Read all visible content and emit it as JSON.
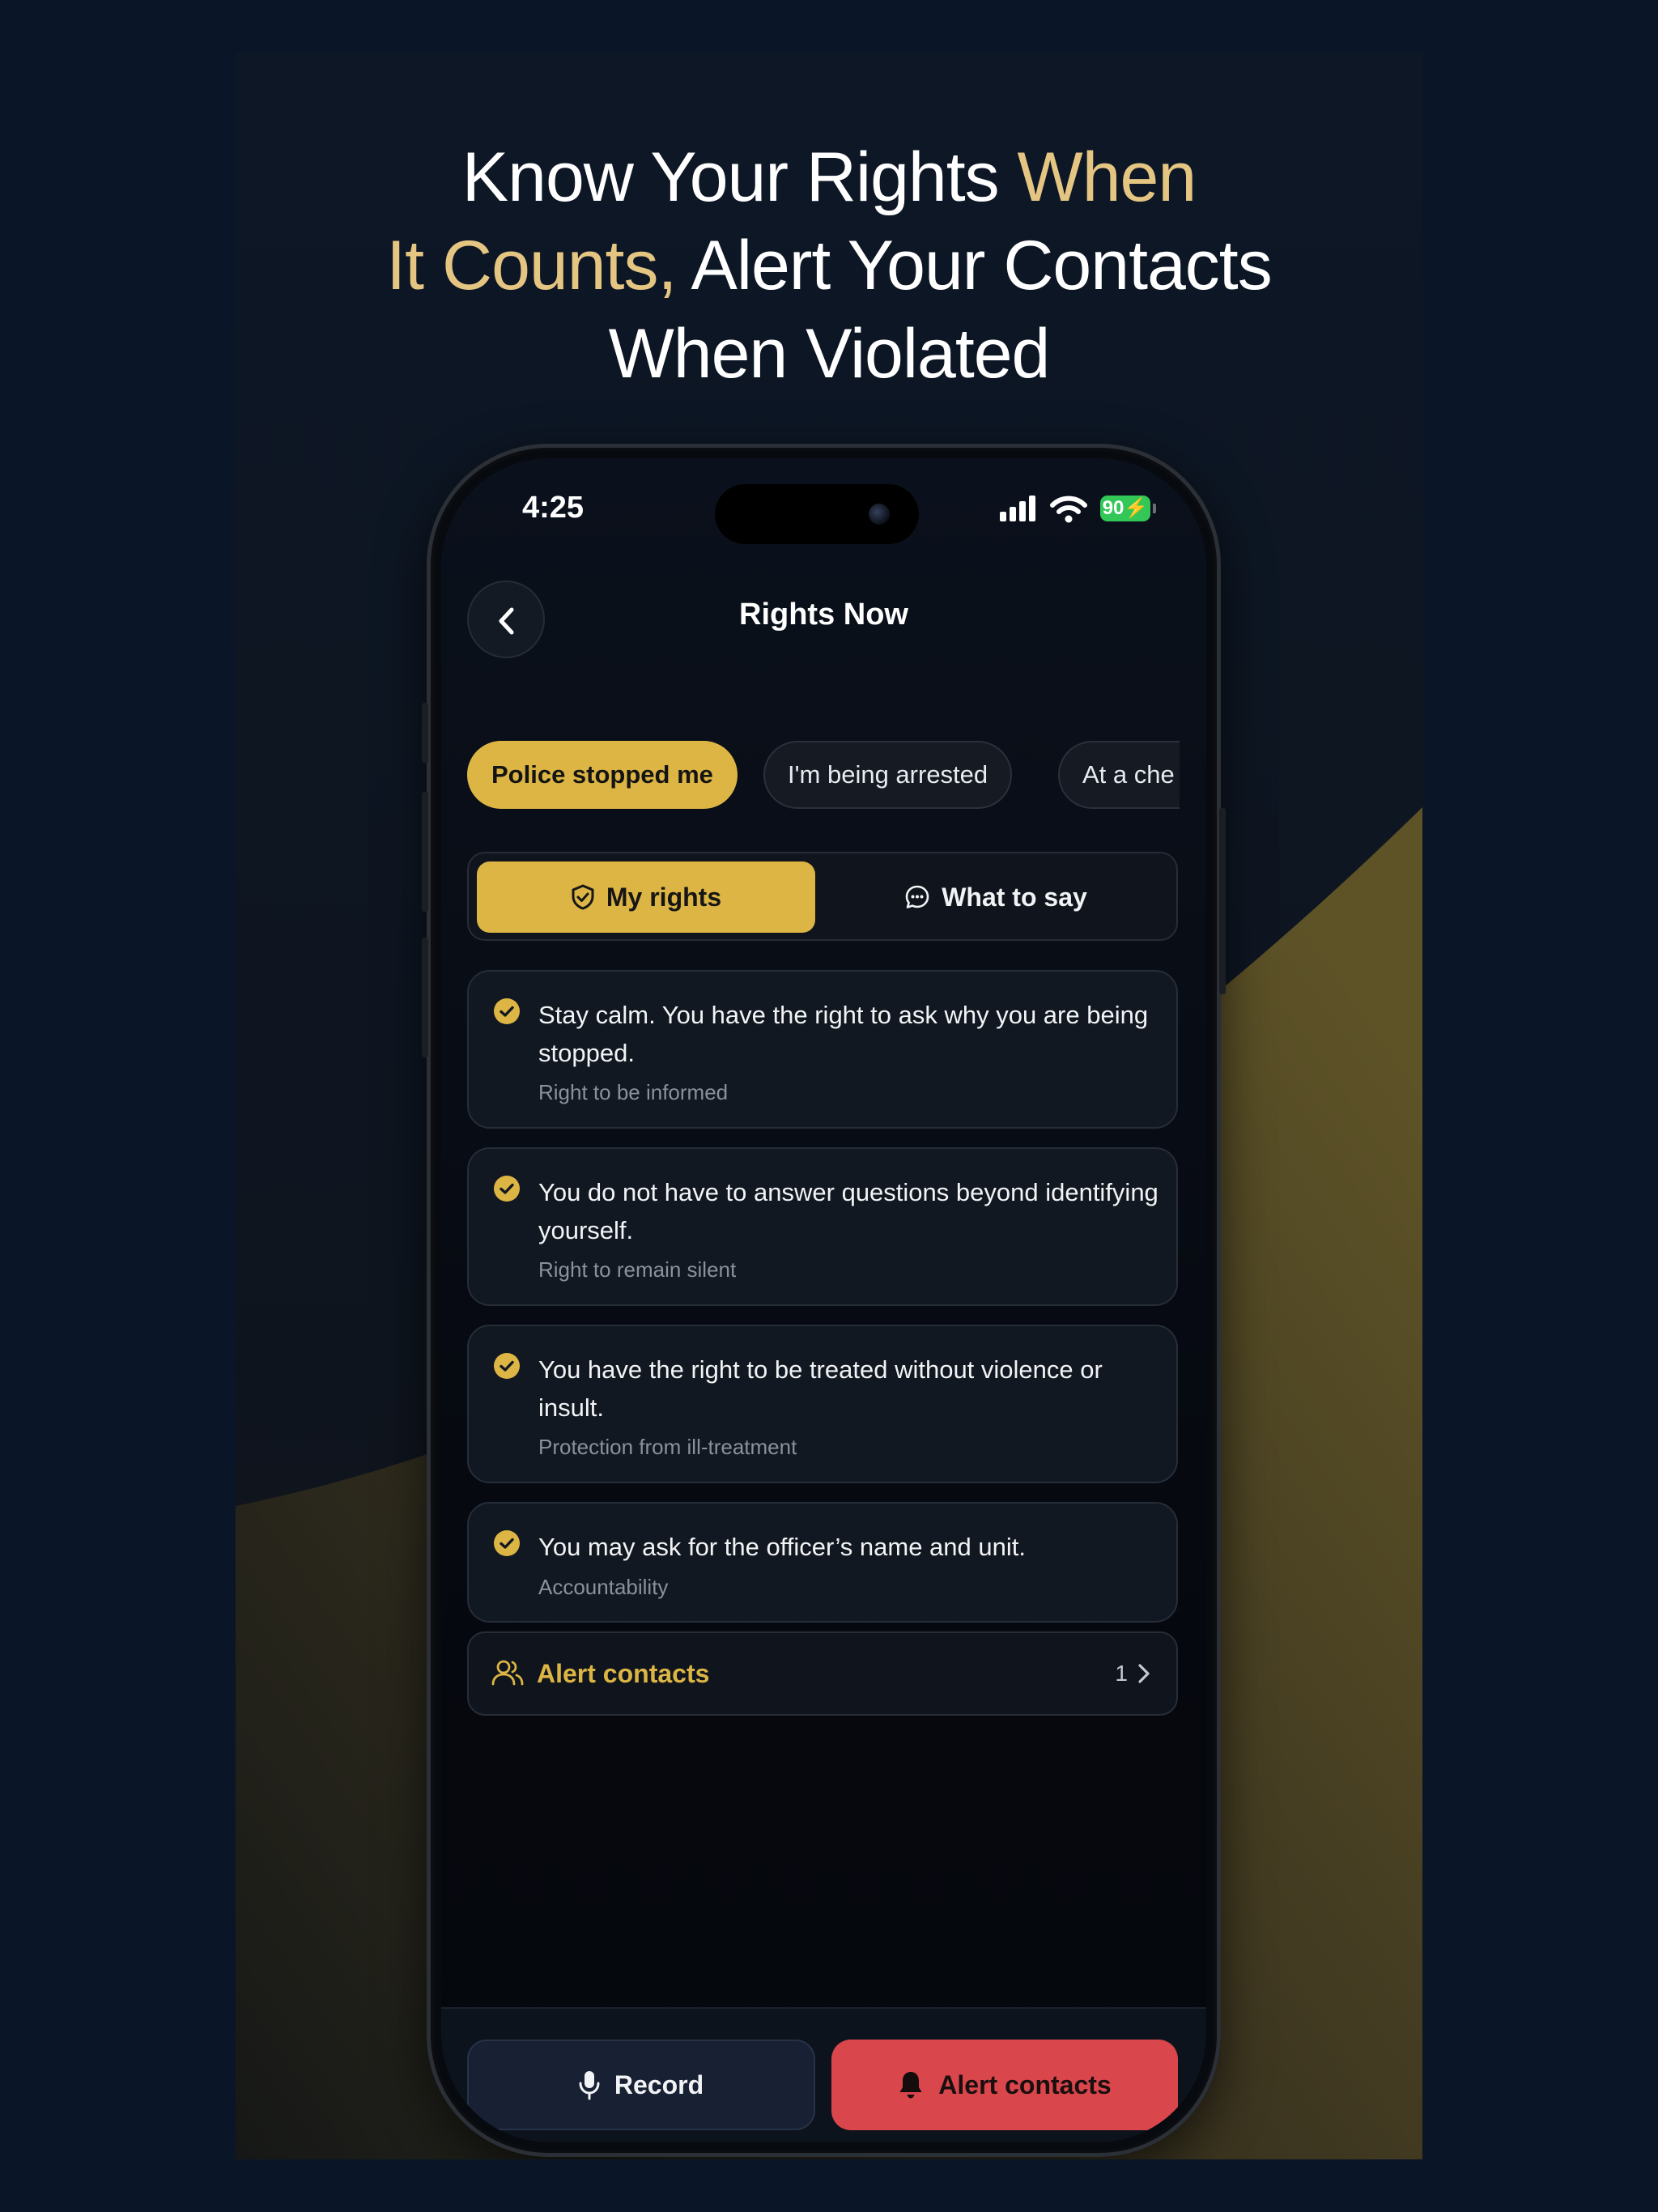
{
  "headline": {
    "line1_white": "Know Your Rights ",
    "line1_gold": "When",
    "line2_gold": "It Counts,",
    "line2_white": " Alert Your Contacts",
    "line3_white": "When Violated"
  },
  "colors": {
    "accent_gold": "#dcb544",
    "headline_gold": "#e5c582",
    "alert_red": "#d9464c",
    "battery_green": "#33c758"
  },
  "status_bar": {
    "time": "4:25",
    "battery": "90"
  },
  "header": {
    "title": "Rights Now",
    "back_icon": "chevron-left-icon"
  },
  "scenarios": [
    "Police stopped me",
    "I'm being arrested",
    "At a che"
  ],
  "tabs": [
    {
      "label": "My rights",
      "icon": "shield-check-icon",
      "active": true
    },
    {
      "label": "What to say",
      "icon": "chat-bubble-icon",
      "active": false
    }
  ],
  "rights": [
    {
      "text": "Stay calm. You have the right to ask why you are being stopped.",
      "tag": "Right to be informed"
    },
    {
      "text": "You do not have to answer questions beyond identifying yourself.",
      "tag": "Right to remain silent"
    },
    {
      "text": "You have the right to be treated without violence or insult.",
      "tag": "Protection from ill-treatment"
    },
    {
      "text": "You may ask for the officer’s name and unit.",
      "tag": "Accountability"
    }
  ],
  "alert_contacts_row": {
    "label": "Alert contacts",
    "count": "1",
    "icon": "people-icon"
  },
  "bottom_actions": {
    "record": {
      "label": "Record",
      "icon": "microphone-icon"
    },
    "alert": {
      "label": "Alert contacts",
      "icon": "bell-icon"
    }
  }
}
